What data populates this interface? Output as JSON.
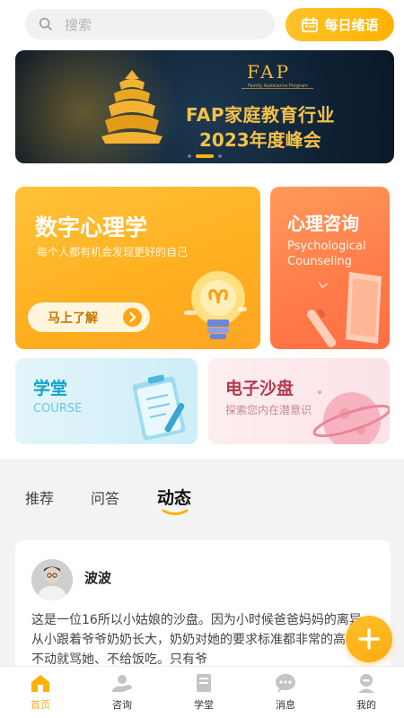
{
  "header": {
    "search_placeholder": "搜索",
    "daily_button": "每日绪语"
  },
  "banner": {
    "logo_text": "FAP",
    "logo_subtitle": "Family Assistance Program",
    "title_line1": "FAP家庭教育行业",
    "title_line2": "2023年度峰会",
    "slide_count": 3,
    "active_slide": 2
  },
  "features": {
    "digital": {
      "title": "数字心理学",
      "subtitle": "每个人都有机会发现更好的自己",
      "cta": "马上了解"
    },
    "consult": {
      "title": "心理咨询",
      "subtitle_en_line1": "Psychological",
      "subtitle_en_line2": "Counseling"
    },
    "course": {
      "title": "学堂",
      "subtitle_en": "COURSE"
    },
    "sandbox": {
      "title": "电子沙盘",
      "subtitle": "探索您内在潜意识"
    }
  },
  "feed_tabs": [
    {
      "label": "推荐",
      "active": false
    },
    {
      "label": "问答",
      "active": false
    },
    {
      "label": "动态",
      "active": true
    }
  ],
  "post": {
    "author": "波波",
    "text": "这是一位16所以小姑娘的沙盘。因为小时候爸爸妈妈的离异，从小跟着爷爷奶奶长大，奶奶对她的要求标准都非常的高，动不动就骂她、不给饭吃。只有爷"
  },
  "bottom_nav": [
    {
      "label": "首页",
      "icon": "home-icon",
      "active": true
    },
    {
      "label": "咨询",
      "icon": "consult-icon",
      "active": false
    },
    {
      "label": "学堂",
      "icon": "book-icon",
      "active": false
    },
    {
      "label": "消息",
      "icon": "message-icon",
      "active": false
    },
    {
      "label": "我的",
      "icon": "profile-icon",
      "active": false
    }
  ],
  "colors": {
    "accent": "#ffb000",
    "digital_card": "#ffb020",
    "consult_card": "#ff7b48",
    "course_title": "#10a5c4",
    "sandbox_title": "#b23a4e"
  }
}
